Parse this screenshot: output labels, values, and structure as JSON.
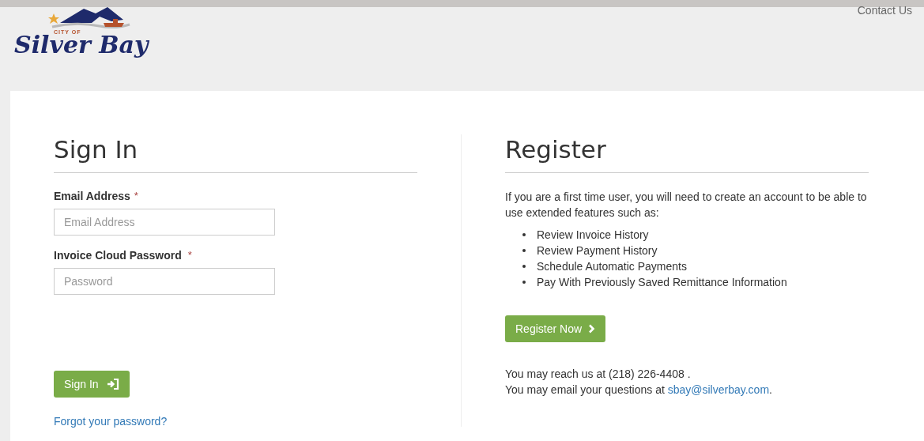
{
  "header": {
    "logo": {
      "small_text": "CITY OF",
      "name": "Silver Bay"
    },
    "contact_link": "Contact Us"
  },
  "sign_in": {
    "title": "Sign In",
    "fields": [
      {
        "label": "Email Address",
        "required_mark": "*",
        "placeholder": "Email Address"
      },
      {
        "label": "Invoice Cloud Password",
        "required_mark": "*",
        "placeholder": "Password"
      }
    ],
    "button": "Sign In",
    "forgot_link": "Forgot your password?"
  },
  "register": {
    "title": "Register",
    "intro": "If you are a first time user, you will need to create an account to be able to use extended features such as:",
    "features": [
      "Review Invoice History",
      "Review Payment History",
      "Schedule Automatic Payments",
      "Pay With Previously Saved Remittance Information"
    ],
    "button": "Register Now",
    "phone_text": "You may reach us at (218) 226-4408 .",
    "email_text": "You may email your questions at ",
    "email_link": "sbay@silverbay.com",
    "email_end": "."
  }
}
